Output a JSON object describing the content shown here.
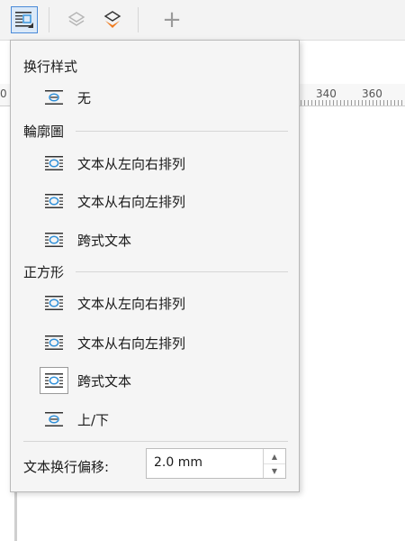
{
  "toolbar": {
    "plus_label": "+"
  },
  "ruler": {
    "left_label": "0",
    "labels": [
      "340",
      "360"
    ]
  },
  "menu": {
    "wrap_style_title": "换行样式",
    "none_label": "无",
    "outline_title": "輪廓圖",
    "outline_items": [
      "文本从左向右排列",
      "文本从右向左排列",
      "跨式文本"
    ],
    "square_title": "正方形",
    "square_items": [
      "文本从左向右排列",
      "文本从右向左排列",
      "跨式文本",
      "上/下"
    ],
    "offset_label": "文本换行偏移:",
    "offset_value": "2.0 mm"
  },
  "colors": {
    "accent": "#2f8fd8",
    "orange": "#f07a1c"
  }
}
